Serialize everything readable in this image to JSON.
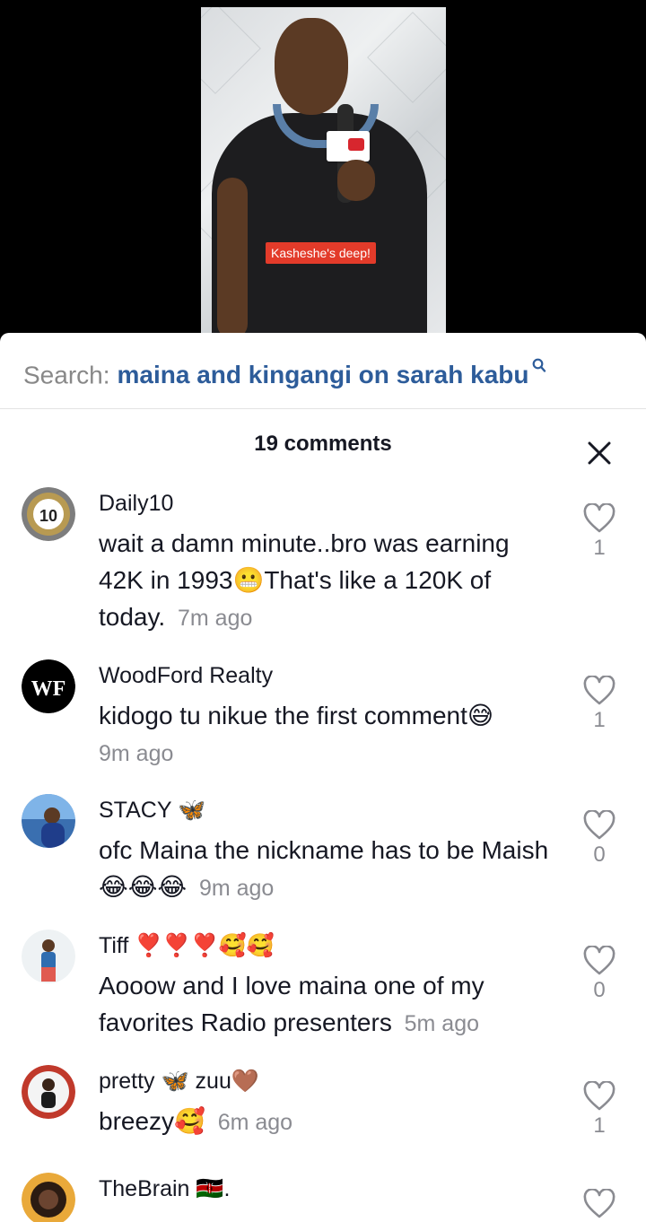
{
  "video": {
    "caption": "Kasheshe's deep!"
  },
  "search": {
    "prefix": "Search:",
    "query": "maina and kingangi on sarah kabu"
  },
  "comments_panel": {
    "title": "19 comments"
  },
  "comments": [
    {
      "username": "Daily10",
      "text": "wait a damn minute..bro was earning 42K in 1993😬That's like a 120K of today.",
      "time": "7m ago",
      "likes": "1"
    },
    {
      "username": "WoodFord Realty",
      "text": "kidogo tu nikue the first comment😅",
      "time": "9m ago",
      "likes": "1"
    },
    {
      "username": "STACY 🦋",
      "text": "ofc Maina the nickname has to be Maish😂😂😂",
      "time": "9m ago",
      "likes": "0"
    },
    {
      "username": "Tiff ❣️❣️❣️🥰🥰",
      "text": "Aooow and I love maina one of my favorites Radio presenters",
      "time": "5m ago",
      "likes": "0"
    },
    {
      "username": "pretty 🦋 zuu🤎",
      "text": "breezy🥰",
      "time": "6m ago",
      "likes": "1"
    },
    {
      "username": "TheBrain 🇰🇪.",
      "text": "",
      "time": "",
      "likes": ""
    }
  ],
  "colors": {
    "link_blue": "#2d5c9a",
    "caption_red": "#e33b2a",
    "muted_gray": "#8a8b91"
  }
}
